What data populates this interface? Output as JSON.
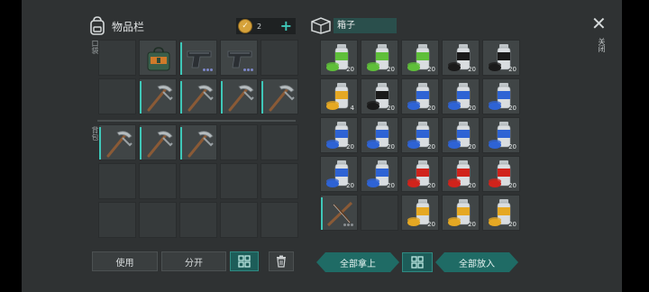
{
  "inventory": {
    "title": "物品栏",
    "coin_count": "2",
    "plus": "+",
    "quick_label": "口袋",
    "backpack_label": "背包",
    "use_label": "使用",
    "split_label": "分开"
  },
  "box": {
    "title": "箱子",
    "take_all_label": "全部拿上",
    "put_all_label": "全部放入"
  },
  "close": {
    "icon": "✕",
    "label": "关闭"
  },
  "quick_slots": [
    {
      "item": "",
      "count": ""
    },
    {
      "item": "green-backpack",
      "count": ""
    },
    {
      "item": "pistol",
      "count": "",
      "selected": true
    },
    {
      "item": "pistol",
      "count": ""
    },
    {
      "item": "",
      "count": ""
    },
    {
      "item": "",
      "count": ""
    },
    {
      "item": "pickaxe",
      "count": "",
      "selected": true
    },
    {
      "item": "pickaxe",
      "count": "",
      "selected": true
    },
    {
      "item": "pickaxe",
      "count": "",
      "selected": true
    },
    {
      "item": "pickaxe",
      "count": "",
      "selected": true
    }
  ],
  "backpack_slots": [
    {
      "item": "pickaxe",
      "count": "",
      "selected": true
    },
    {
      "item": "pickaxe",
      "count": "",
      "selected": true
    },
    {
      "item": "pickaxe",
      "count": "",
      "selected": true
    },
    {
      "item": "",
      "count": ""
    },
    {
      "item": "",
      "count": ""
    },
    {
      "item": "",
      "count": ""
    },
    {
      "item": "",
      "count": ""
    },
    {
      "item": "",
      "count": ""
    },
    {
      "item": "",
      "count": ""
    },
    {
      "item": "",
      "count": ""
    },
    {
      "item": "",
      "count": ""
    },
    {
      "item": "",
      "count": ""
    },
    {
      "item": "",
      "count": ""
    },
    {
      "item": "",
      "count": ""
    },
    {
      "item": "",
      "count": ""
    }
  ],
  "box_slots": [
    {
      "item": "spray-green",
      "count": "20",
      "color": "#5fbf3a"
    },
    {
      "item": "spray-green",
      "count": "20",
      "color": "#5fbf3a"
    },
    {
      "item": "spray-green",
      "count": "20",
      "color": "#5fbf3a"
    },
    {
      "item": "spray-black",
      "count": "20",
      "color": "#1a1a1a"
    },
    {
      "item": "spray-black",
      "count": "20",
      "color": "#1a1a1a"
    },
    {
      "item": "spray-yellow",
      "count": "4",
      "color": "#e5a823"
    },
    {
      "item": "spray-black",
      "count": "20",
      "color": "#1a1a1a"
    },
    {
      "item": "spray-blue",
      "count": "20",
      "color": "#2e63d4"
    },
    {
      "item": "spray-blue",
      "count": "20",
      "color": "#2e63d4"
    },
    {
      "item": "spray-blue",
      "count": "20",
      "color": "#2e63d4"
    },
    {
      "item": "spray-blue",
      "count": "20",
      "color": "#2e63d4"
    },
    {
      "item": "spray-blue",
      "count": "20",
      "color": "#2e63d4"
    },
    {
      "item": "spray-blue",
      "count": "20",
      "color": "#2e63d4"
    },
    {
      "item": "spray-blue",
      "count": "20",
      "color": "#2e63d4"
    },
    {
      "item": "spray-blue",
      "count": "20",
      "color": "#2e63d4"
    },
    {
      "item": "spray-blue",
      "count": "20",
      "color": "#2e63d4"
    },
    {
      "item": "spray-blue",
      "count": "20",
      "color": "#2e63d4"
    },
    {
      "item": "spray-red",
      "count": "20",
      "color": "#d0231c"
    },
    {
      "item": "spray-red",
      "count": "20",
      "color": "#d0231c"
    },
    {
      "item": "spray-red",
      "count": "20",
      "color": "#d0231c"
    },
    {
      "item": "crossbow",
      "count": "",
      "selected": true
    },
    {
      "item": "",
      "count": ""
    },
    {
      "item": "spray-yellow",
      "count": "20",
      "color": "#e5a823"
    },
    {
      "item": "spray-yellow",
      "count": "20",
      "color": "#e5a823"
    },
    {
      "item": "spray-yellow",
      "count": "20",
      "color": "#e5a823"
    }
  ]
}
